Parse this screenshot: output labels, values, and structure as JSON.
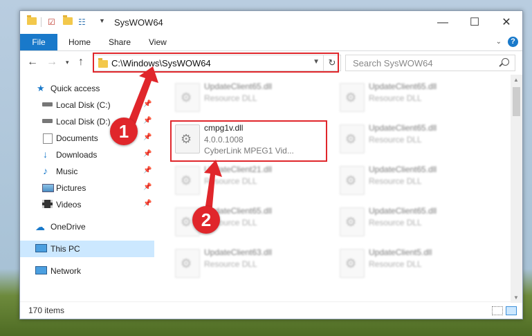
{
  "window": {
    "title": "SysWOW64"
  },
  "ribbon": {
    "tabs": [
      "File",
      "Home",
      "Share",
      "View"
    ]
  },
  "address": {
    "path": "C:\\Windows\\SysWOW64"
  },
  "search": {
    "placeholder": "Search SysWOW64"
  },
  "sidebar": {
    "items": [
      {
        "label": "Quick access",
        "icon": "star-icon"
      },
      {
        "label": "Local Disk (C:)",
        "icon": "drive-icon",
        "pinned": true
      },
      {
        "label": "Local Disk (D:)",
        "icon": "drive-icon",
        "pinned": true
      },
      {
        "label": "Documents",
        "icon": "documents-icon",
        "pinned": true
      },
      {
        "label": "Downloads",
        "icon": "download-icon",
        "pinned": true
      },
      {
        "label": "Music",
        "icon": "music-icon",
        "pinned": true
      },
      {
        "label": "Pictures",
        "icon": "pictures-icon",
        "pinned": true
      },
      {
        "label": "Videos",
        "icon": "videos-icon",
        "pinned": true
      },
      {
        "label": "OneDrive",
        "icon": "cloud-icon"
      },
      {
        "label": "This PC",
        "icon": "pc-icon",
        "selected": true
      },
      {
        "label": "Network",
        "icon": "network-icon"
      }
    ]
  },
  "files": [
    {
      "name": "UpdateClient65.dll",
      "type": "Resource DLL"
    },
    {
      "name": "UpdateClient65.dll",
      "type": "Resource DLL"
    },
    {
      "name": "cmpg1v.dll",
      "version": "4.0.0.1008",
      "desc": "CyberLink MPEG1 Vid...",
      "highlighted": true
    },
    {
      "name": "UpdateClient65.dll",
      "type": "Resource DLL"
    },
    {
      "name": "UpdateClient21.dll",
      "type": "Resource DLL"
    },
    {
      "name": "UpdateClient65.dll",
      "type": "Resource DLL"
    },
    {
      "name": "UpdateClient65.dll",
      "type": "Resource DLL"
    },
    {
      "name": "UpdateClient65.dll",
      "type": "Resource DLL"
    },
    {
      "name": "UpdateClient63.dll",
      "type": "Resource DLL"
    },
    {
      "name": "UpdateClient5.dll",
      "type": "Resource DLL"
    }
  ],
  "status": {
    "count": "170 items"
  },
  "annotations": {
    "step1": "1",
    "step2": "2",
    "color": "#e0262b"
  }
}
